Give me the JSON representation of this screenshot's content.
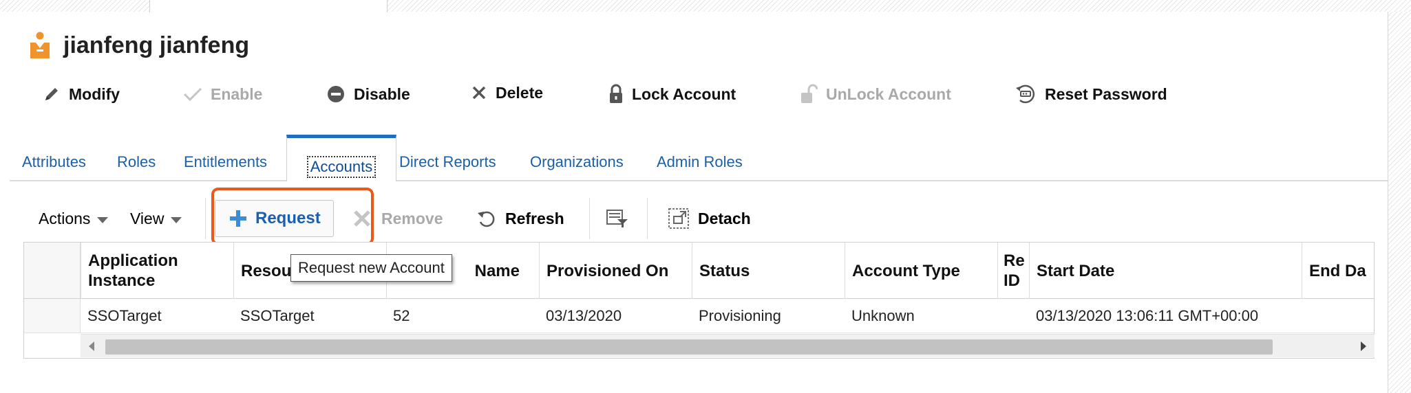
{
  "header": {
    "title": "jianfeng jianfeng",
    "icon": "person-icon",
    "accent": "#f0932b"
  },
  "toolbar": {
    "modify": "Modify",
    "enable": "Enable",
    "disable": "Disable",
    "delete": "Delete",
    "lock": "Lock Account",
    "unlock": "UnLock Account",
    "reset": "Reset Password"
  },
  "tabs": [
    {
      "label": "Attributes"
    },
    {
      "label": "Roles"
    },
    {
      "label": "Entitlements"
    },
    {
      "label": "Accounts",
      "active": true
    },
    {
      "label": "Direct Reports"
    },
    {
      "label": "Organizations"
    },
    {
      "label": "Admin Roles"
    }
  ],
  "table_toolbar": {
    "actions": "Actions",
    "view": "View",
    "request": "Request",
    "remove": "Remove",
    "refresh": "Refresh",
    "detach": "Detach"
  },
  "tooltip": "Request new Account",
  "table": {
    "columns": [
      {
        "line1": "Application",
        "line2": "Instance"
      },
      {
        "line1": "Resou",
        "line2": ""
      },
      {
        "line1": "Name",
        "line2": ""
      },
      {
        "line1": "Provisioned On",
        "line2": ""
      },
      {
        "line1": "Status",
        "line2": ""
      },
      {
        "line1": "Account Type",
        "line2": ""
      },
      {
        "line1": "Re",
        "line2": "ID"
      },
      {
        "line1": "Start Date",
        "line2": ""
      },
      {
        "line1": "End Da",
        "line2": ""
      }
    ],
    "rows": [
      [
        "SSOTarget",
        "SSOTarget",
        "52",
        "03/13/2020",
        "Provisioning",
        "Unknown",
        "",
        "03/13/2020 13:06:11 GMT+00:00",
        ""
      ]
    ]
  },
  "colors": {
    "link": "#1a5fa8",
    "active_tab_border": "#1f6ec4",
    "highlight": "#e8591a",
    "disabled": "#a9a9a9"
  }
}
